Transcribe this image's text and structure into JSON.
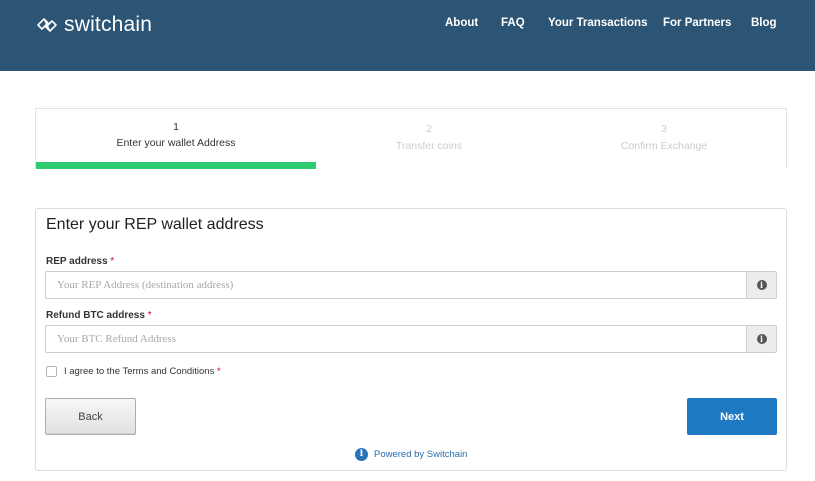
{
  "header": {
    "brand": "switchain",
    "nav": [
      {
        "label": "About"
      },
      {
        "label": "FAQ"
      },
      {
        "label": "Your Transactions"
      },
      {
        "label": "For Partners"
      },
      {
        "label": "Blog"
      }
    ]
  },
  "steps": [
    {
      "number": "1",
      "label": "Enter your wallet Address",
      "state": "active"
    },
    {
      "number": "2",
      "label": "Transfer coins",
      "state": "inactive"
    },
    {
      "number": "3",
      "label": "Confirm Exchange",
      "state": "inactive"
    }
  ],
  "progress": {
    "fraction": 0.333
  },
  "form": {
    "title": "Enter your REP wallet address",
    "rep_field": {
      "label": "REP address",
      "required_mark": "*",
      "placeholder": "Your REP Address (destination address)",
      "value": ""
    },
    "refund_field": {
      "label": "Refund BTC address",
      "required_mark": "*",
      "placeholder": "Your BTC Refund Address",
      "value": ""
    },
    "terms": {
      "label": "I agree to the Terms and Conditions",
      "required_mark": "*",
      "checked": false
    },
    "back_label": "Back",
    "next_label": "Next",
    "powered_by": "Powered by Switchain",
    "info_glyph": "i"
  },
  "colors": {
    "header_bg": "#2c5474",
    "progress": "#2ecc71",
    "primary_button": "#1f78c2",
    "required": "#d0021b",
    "link": "#2a6db0"
  }
}
